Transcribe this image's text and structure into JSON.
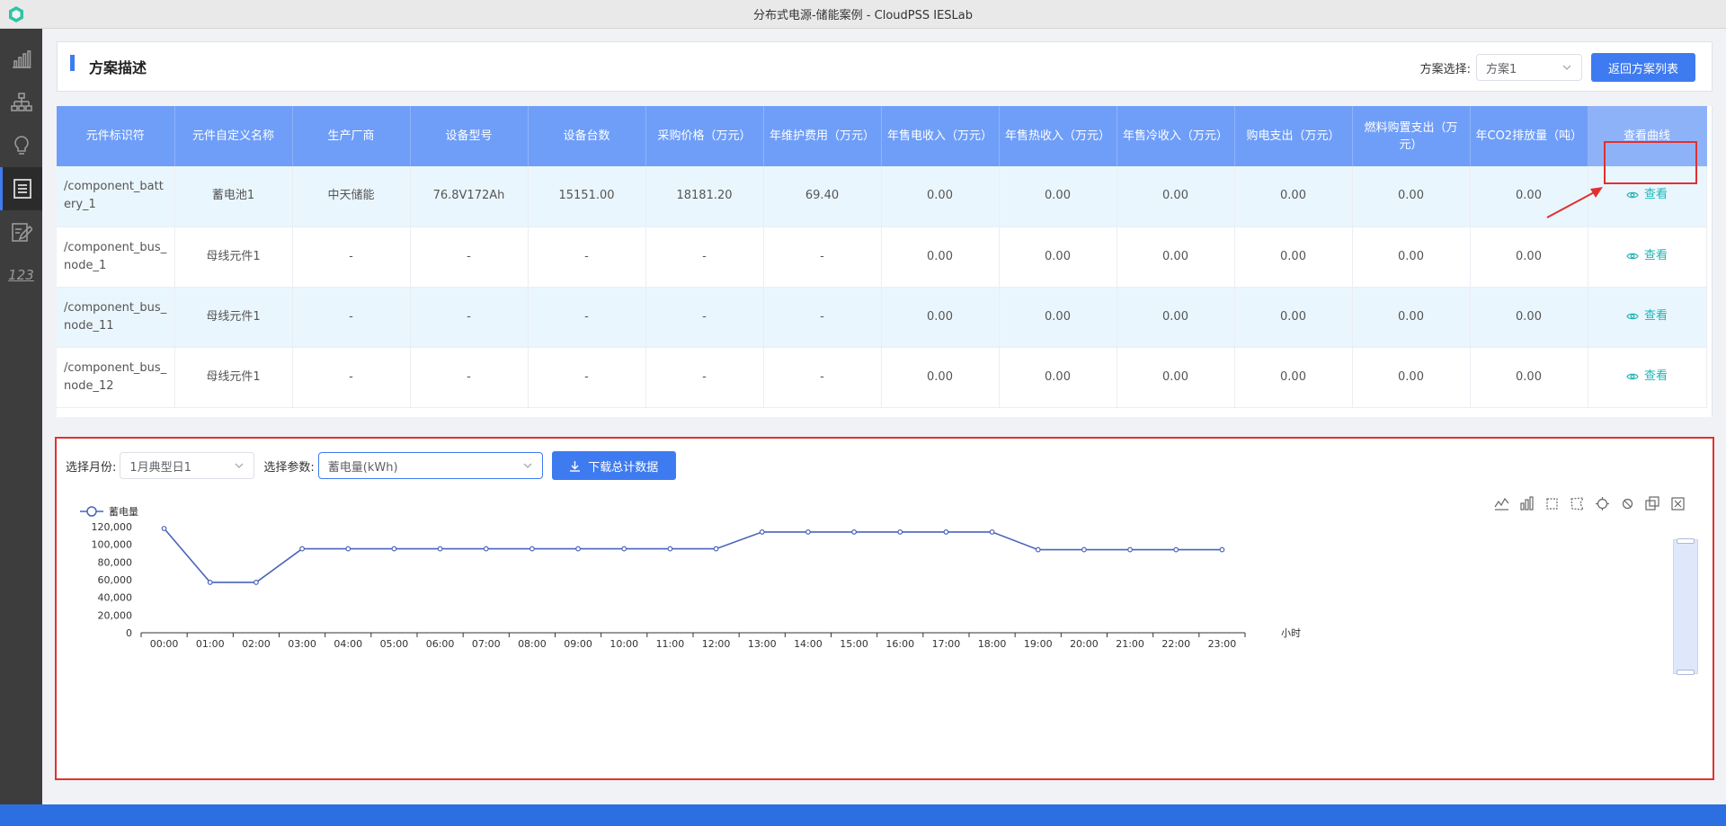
{
  "window": {
    "title": "分布式电源-储能案例 - CloudPSS IESLab"
  },
  "sidebar": {
    "items": [
      {
        "icon": "bar-chart-icon"
      },
      {
        "icon": "topology-icon"
      },
      {
        "icon": "lightbulb-icon"
      },
      {
        "icon": "document-list-icon",
        "active": true
      },
      {
        "icon": "edit-document-icon"
      },
      {
        "icon": "numbers-icon",
        "text": "123"
      }
    ]
  },
  "header": {
    "title": "方案描述",
    "scheme_label": "方案选择:",
    "scheme_value": "方案1",
    "back_button": "返回方案列表"
  },
  "table": {
    "columns": [
      "元件标识符",
      "元件自定义名称",
      "生产厂商",
      "设备型号",
      "设备台数",
      "采购价格（万元）",
      "年维护费用（万元）",
      "年售电收入（万元）",
      "年售热收入（万元）",
      "年售冷收入（万元）",
      "购电支出（万元）",
      "燃料购置支出（万元）",
      "年CO2排放量（吨）",
      "查看曲线"
    ],
    "view_label": "查看",
    "rows": [
      [
        "/component_battery_1",
        "蓄电池1",
        "中天储能",
        "76.8V172Ah",
        "15151.00",
        "18181.20",
        "69.40",
        "0.00",
        "0.00",
        "0.00",
        "0.00",
        "0.00",
        "0.00"
      ],
      [
        "/component_bus_node_1",
        "母线元件1",
        "-",
        "-",
        "-",
        "-",
        "-",
        "0.00",
        "0.00",
        "0.00",
        "0.00",
        "0.00",
        "0.00"
      ],
      [
        "/component_bus_node_11",
        "母线元件1",
        "-",
        "-",
        "-",
        "-",
        "-",
        "0.00",
        "0.00",
        "0.00",
        "0.00",
        "0.00",
        "0.00"
      ],
      [
        "/component_bus_node_12",
        "母线元件1",
        "-",
        "-",
        "-",
        "-",
        "-",
        "0.00",
        "0.00",
        "0.00",
        "0.00",
        "0.00",
        "0.00"
      ]
    ]
  },
  "chart_panel": {
    "month_label": "选择月份:",
    "month_value": "1月典型日1",
    "param_label": "选择参数:",
    "param_value": "蓄电量(kWh)",
    "download_button": "下载总计数据",
    "toolbox_icons": [
      "line-chart-icon",
      "bar-chart-icon",
      "rect-select-icon",
      "lasso-select-icon",
      "keep-select-icon",
      "clear-select-icon",
      "data-zoom-icon",
      "zoom-reset-icon"
    ]
  },
  "chart_data": {
    "type": "line",
    "legend": "蓄电量",
    "x_unit": "小时",
    "categories": [
      "00:00",
      "01:00",
      "02:00",
      "03:00",
      "04:00",
      "05:00",
      "06:00",
      "07:00",
      "08:00",
      "09:00",
      "10:00",
      "11:00",
      "12:00",
      "13:00",
      "14:00",
      "15:00",
      "16:00",
      "17:00",
      "18:00",
      "19:00",
      "20:00",
      "21:00",
      "22:00",
      "23:00"
    ],
    "values": [
      118000,
      57000,
      57000,
      95000,
      95000,
      95000,
      95000,
      95000,
      95000,
      95000,
      95000,
      95000,
      95000,
      114000,
      114000,
      114000,
      114000,
      114000,
      114000,
      94000,
      94000,
      94000,
      94000,
      94000
    ],
    "yticks": [
      "120,000",
      "100,000",
      "80,000",
      "60,000",
      "40,000",
      "20,000",
      "0"
    ],
    "ylim": [
      0,
      120000
    ],
    "color": "#4a63b8"
  },
  "colors": {
    "accent": "#3f7bf0",
    "header_bg": "#6f9ef8",
    "view_link": "#1fb6b6",
    "highlight": "#e03131"
  }
}
